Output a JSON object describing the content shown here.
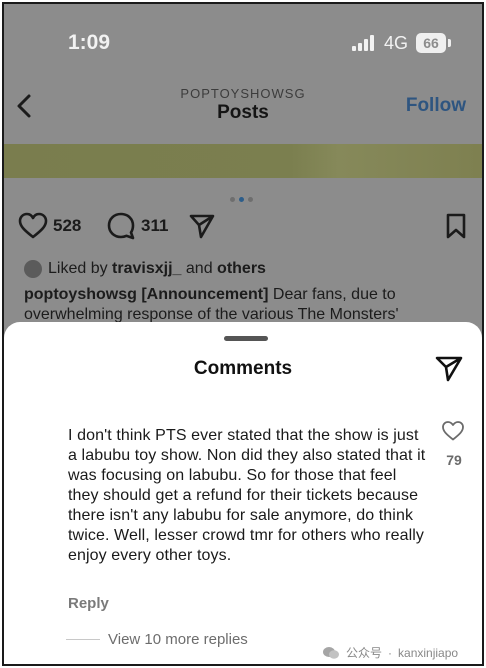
{
  "status_bar": {
    "time": "1:09",
    "network": "4G",
    "battery": "66"
  },
  "header": {
    "account": "POPTOYSHOWSG",
    "title": "Posts",
    "follow_label": "Follow"
  },
  "post": {
    "likes": "528",
    "comments": "311",
    "liked_by_prefix": "Liked by",
    "liked_by_user": "travisxjj_",
    "liked_by_mid": "and",
    "liked_by_others": "others",
    "caption_user": "poptoyshowsg",
    "caption_tag": "[Announcement]",
    "caption_text": "Dear fans, due to overwhelming response of the various The Monsters'"
  },
  "sheet": {
    "title": "Comments",
    "comment": {
      "text": "I don't think PTS ever stated that the show is just a labubu toy show. Non did they also stated that it was focusing on labubu. So for those that feel they should get a refund for their tickets because there isn't any labubu for sale anymore, do think twice. Well, lesser crowd tmr for others who really enjoy every other toys.",
      "like_count": "79",
      "reply_label": "Reply",
      "view_replies": "View 10 more replies"
    }
  },
  "watermark": {
    "source": "公众号",
    "account": "kanxinjiapo"
  },
  "colors": {
    "follow": "#2e5580",
    "overlay": "#8c8c8c",
    "sheet": "#ffffff"
  },
  "icons": [
    "signal-icon",
    "back-chevron-icon",
    "heart-icon",
    "comment-bubble-icon",
    "send-icon",
    "bookmark-icon",
    "share-send-icon",
    "like-heart-icon",
    "wechat-icon"
  ]
}
